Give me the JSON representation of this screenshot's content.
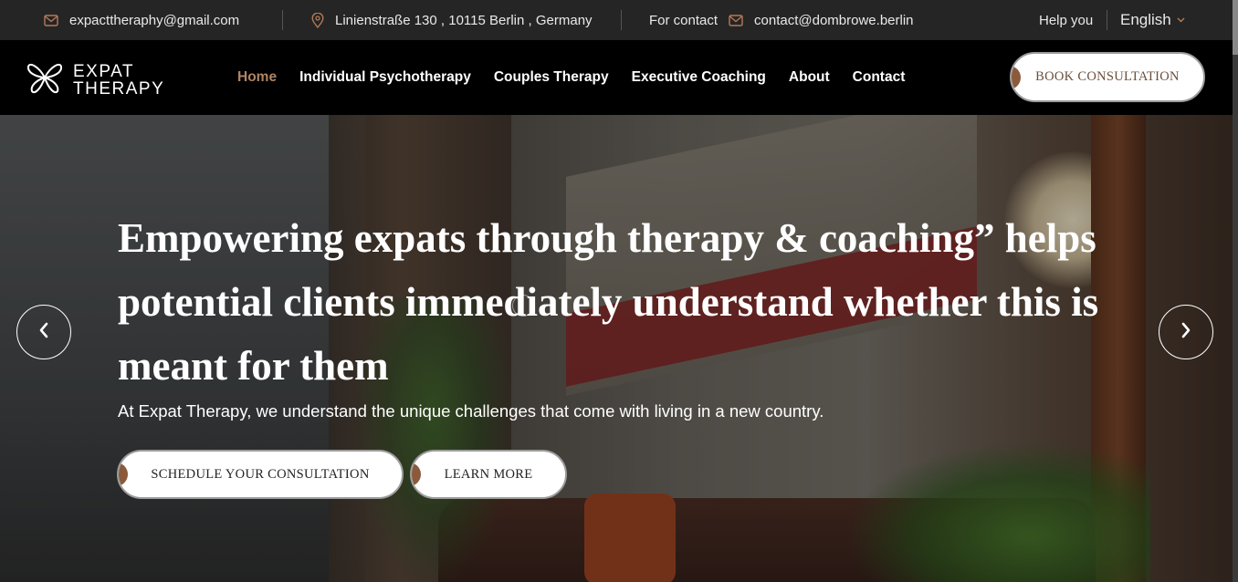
{
  "topbar": {
    "email": "expacttheraphy@gmail.com",
    "address": "Linienstraße 130 , 10115 Berlin , Germany",
    "contact_label": "For contact",
    "contact_email": "contact@dombrowe.berlin",
    "help_label": "Help you",
    "language": "English"
  },
  "nav": {
    "logo_line1": "EXPAT",
    "logo_line2": "THERAPY",
    "items": [
      {
        "label": "Home"
      },
      {
        "label": "Individual Psychotherapy"
      },
      {
        "label": "Couples Therapy"
      },
      {
        "label": "Executive Coaching"
      },
      {
        "label": "About"
      },
      {
        "label": "Contact"
      }
    ],
    "cta": "BOOK CONSULTATION"
  },
  "hero": {
    "title": "Empowering expats through therapy & coaching” helps potential clients immediately understand whether this is meant for them",
    "subtitle": "At Expat Therapy, we understand the unique challenges that come with living in a new country.",
    "primary_button": "SCHEDULE YOUR CONSULTATION",
    "secondary_button": "LEARN MORE"
  },
  "colors": {
    "accent": "#b08463",
    "button_dot": "#8a5a3b",
    "icon": "#b57a56"
  },
  "icons": [
    "mail-icon",
    "location-pin-icon",
    "chevron-down-icon",
    "chevron-left-icon",
    "chevron-right-icon",
    "butterfly-logo-icon"
  ]
}
